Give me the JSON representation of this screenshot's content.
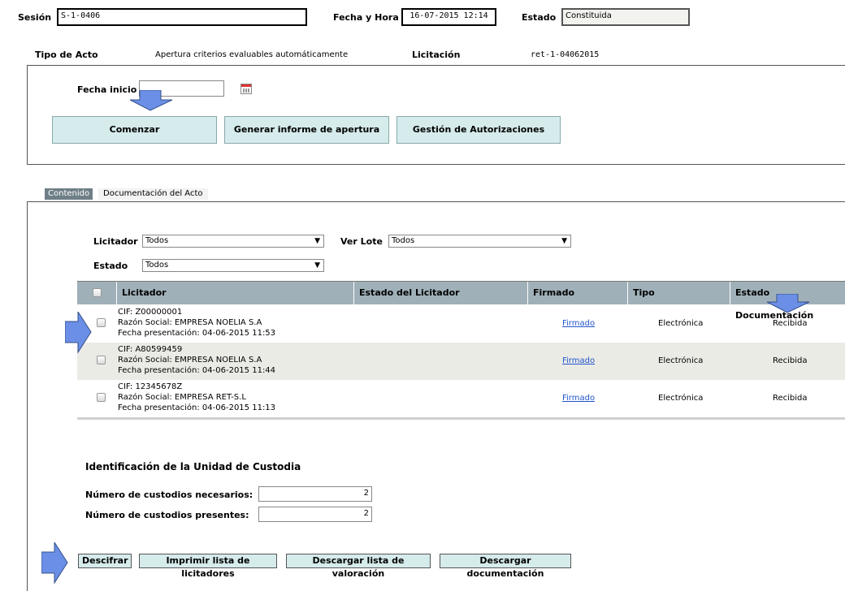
{
  "header": {
    "sesion_label": "Sesión",
    "sesion_value": "S-1-0406",
    "fecha_label": "Fecha y Hora",
    "fecha_value": "16-07-2015 12:14",
    "estado_label": "Estado",
    "estado_value": "Constituida",
    "tipo_acto_label": "Tipo de Acto",
    "tipo_acto_value": "Apertura criterios evaluables automáticamente",
    "licitacion_label": "Licitación",
    "licitacion_value": "ret-1-04062015"
  },
  "top_panel": {
    "fecha_inicio_label": "Fecha inicio",
    "fecha_inicio_value": "",
    "buttons": {
      "comenzar": "Comenzar",
      "generar": "Generar informe de apertura",
      "gestion": "Gestión de Autorizaciones"
    }
  },
  "tabs": {
    "contenido": "Contenido",
    "documentacion": "Documentación del Acto"
  },
  "filters": {
    "licitador_label": "Licitador",
    "licitador_value": "Todos",
    "ver_lote_label": "Ver Lote",
    "ver_lote_value": "Todos",
    "estado_label": "Estado",
    "estado_value": "Todos"
  },
  "table": {
    "headers": {
      "licitador": "Licitador",
      "estado_licitador": "Estado del Licitador",
      "firmado": "Firmado",
      "tipo": "Tipo",
      "estado_doc": "Estado Documentación"
    },
    "rows": [
      {
        "cif": "CIF: Z00000001",
        "razon": "Razón Social: EMPRESA NOELIA S.A",
        "fecha": "Fecha presentación: 04-06-2015 11:53",
        "firmado": "Firmado",
        "tipo": "Electrónica",
        "estado_doc": "Recibida"
      },
      {
        "cif": "CIF: A80599459",
        "razon": "Razón Social: EMPRESA NOELIA S.A",
        "fecha": "Fecha presentación: 04-06-2015 11:44",
        "firmado": "Firmado",
        "tipo": "Electrónica",
        "estado_doc": "Recibida"
      },
      {
        "cif": "CIF: 12345678Z",
        "razon": "Razón Social: EMPRESA RET-S.L",
        "fecha": "Fecha presentación: 04-06-2015 11:13",
        "firmado": "Firmado",
        "tipo": "Electrónica",
        "estado_doc": "Recibida"
      }
    ]
  },
  "custodia": {
    "title": "Identificación de la Unidad de Custodia",
    "necesarios_label": "Número de custodios necesarios:",
    "necesarios_value": "2",
    "presentes_label": "Número de custodios presentes:",
    "presentes_value": "2"
  },
  "bottom_buttons": {
    "descifrar": "Descifrar",
    "imprimir": "Imprimir lista de licitadores",
    "descargar_valoracion": "Descargar lista de valoración",
    "descargar_doc": "Descargar documentación"
  },
  "colors": {
    "button_bg": "#d6ebeb",
    "table_header_bg": "#9fb0b8",
    "annotation_arrow": "#6b8fe6",
    "link": "#2255cc"
  }
}
